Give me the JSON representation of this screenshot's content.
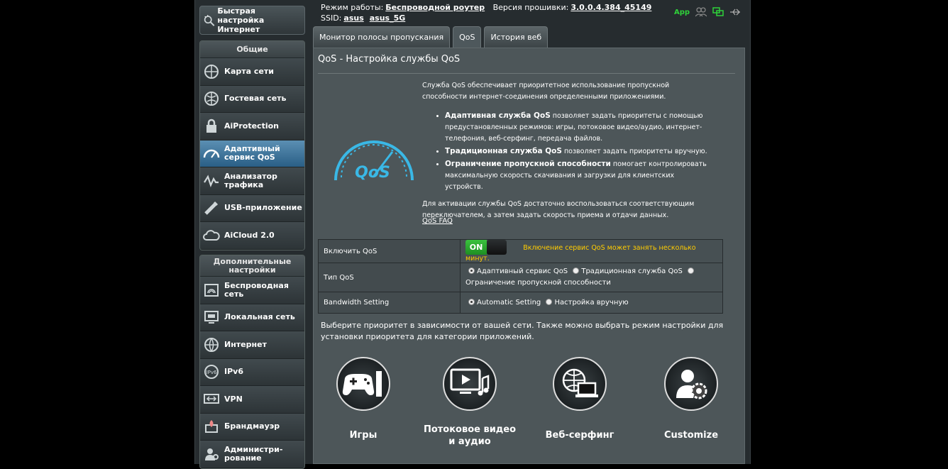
{
  "top": {
    "mode_label": "Режим работы:",
    "mode_value": "Беспроводной роутер",
    "fw_label": "Версия прошивки:",
    "fw_value": "3.0.0.4.384_45149",
    "ssid_label": "SSID:",
    "ssid_1": "asus",
    "ssid_2": "asus_5G",
    "app_label": "App"
  },
  "sidebar": {
    "qis_label": "Быстрая настройка Интернет",
    "general_title": "Общие",
    "general_items": [
      {
        "label": "Карта сети",
        "icon": "network-map-icon"
      },
      {
        "label": "Гостевая сеть",
        "icon": "guest-network-icon"
      },
      {
        "label": "AiProtection",
        "icon": "lock-icon"
      },
      {
        "label": "Адаптивный сервис QoS",
        "icon": "qos-gauge-icon",
        "active": true
      },
      {
        "label": "Анализатор трафика",
        "icon": "traffic-analyzer-icon"
      },
      {
        "label": "USB-приложение",
        "icon": "usb-icon"
      },
      {
        "label": "AiCloud 2.0",
        "icon": "cloud-icon"
      }
    ],
    "advanced_title": "Дополнительные настройки",
    "advanced_items": [
      {
        "label": "Беспроводная сеть",
        "icon": "wireless-icon"
      },
      {
        "label": "Локальная сеть",
        "icon": "lan-icon"
      },
      {
        "label": "Интернет",
        "icon": "globe-icon"
      },
      {
        "label": "IPv6",
        "icon": "ipv6-icon"
      },
      {
        "label": "VPN",
        "icon": "vpn-icon"
      },
      {
        "label": "Брандмауэр",
        "icon": "firewall-icon"
      },
      {
        "label": "Администри-рование",
        "icon": "admin-icon"
      }
    ]
  },
  "tabs": [
    "Монитор полосы пропускания",
    "QoS",
    "История веб"
  ],
  "page": {
    "title": "QoS - Настройка службы QoS",
    "intro": "Служба QoS обеспечивает приоритетное использование пропускной способности интернет-соединения определенными приложениями.",
    "bullets": [
      {
        "bold": "Адаптивная служба QoS",
        "text": " позволяет задать приоритеты с помощью предустановленных режимов: игры, потоковое видео/аудио, интернет-телефония, веб-серфинг, передача файлов."
      },
      {
        "bold": "Традиционная служба QoS",
        "text": " позволяет задать приоритеты вручную."
      },
      {
        "bold": "Ограничение пропускной способности",
        "text": " помогает контролировать максимальную скорость скачивания и загрузки для клиентских устройств."
      }
    ],
    "activate": "Для активации службы QoS достаточно воспользоваться соответствующим переключателем, а затем задать скорость приема и отдачи данных.",
    "faq": "QoS FAQ",
    "gauge_text": "QoS"
  },
  "form": {
    "enable_label": "Включить QoS",
    "toggle_on": "ON",
    "enable_note": "Включение сервис QoS может занять несколько минут.",
    "type_label": "Тип QoS",
    "type_options": [
      "Адаптивный сервис QoS",
      "Традиционная служба QoS",
      "Ограничение пропускной способности"
    ],
    "bw_label": "Bandwidth Setting",
    "bw_options": [
      "Automatic Setting",
      "Настройка вручную"
    ]
  },
  "priority_text": "Выберите приоритет в зависимости от вашей сети. Также можно выбрать режим настройки для установки приоритета для категории приложений.",
  "categories": [
    {
      "name": "Игры",
      "icon": "gamepad-icon"
    },
    {
      "name": "Потоковое видео и аудио",
      "icon": "video-audio-icon"
    },
    {
      "name": "Веб-серфинг",
      "icon": "web-surfing-icon"
    },
    {
      "name": "Customize",
      "icon": "customize-icon"
    }
  ],
  "colors": {
    "accent_green": "#2fd13a",
    "warn": "#ffcc00",
    "active_menu": "#2a5f86",
    "gauge": "#3ab8e6"
  }
}
